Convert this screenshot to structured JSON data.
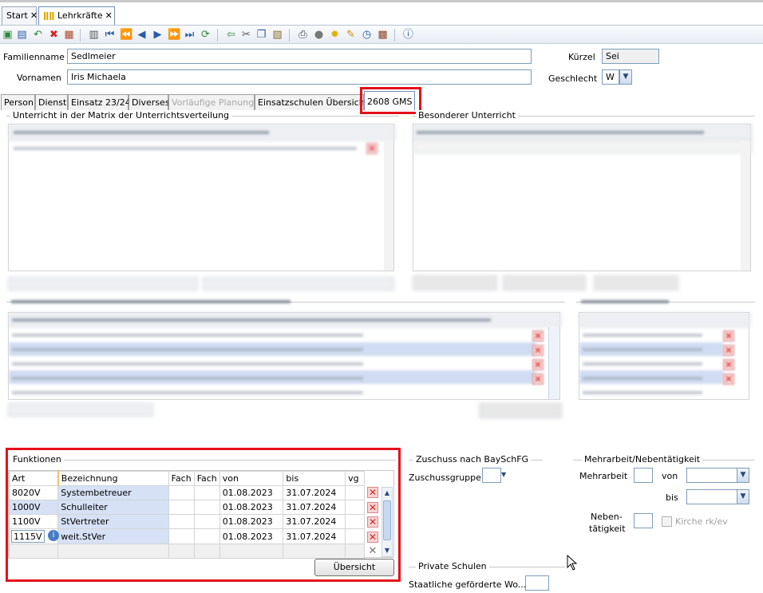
{
  "tabs": [
    {
      "label": "Start"
    },
    {
      "label": "Lehrkräfte"
    }
  ],
  "form": {
    "familienname_label": "Familienname",
    "familienname_value": "Sedlmeier",
    "vornamen_label": "Vornamen",
    "vornamen_value": "Iris Michaela",
    "kuerzel_label": "Kürzel",
    "kuerzel_value": "Sei",
    "geschlecht_label": "Geschlecht",
    "geschlecht_value": "W"
  },
  "page_tabs": [
    "Person",
    "Dienst",
    "Einsatz 23/24",
    "Diverses",
    "Vorläufige Planung",
    "Einsatzschulen Übersicht",
    "2608 GMS"
  ],
  "groups": {
    "matrix": "Unterricht in der Matrix der Unterrichtsverteilung",
    "besonderer": "Besonderer Unterricht",
    "funktionen": "Funktionen",
    "zuschuss": "Zuschuss nach BaySchFG",
    "mehrarbeit": "Mehrarbeit/Nebentätigkeit",
    "private": "Private Schulen"
  },
  "funktionen": {
    "headers": [
      "Art",
      "Bezeichnung",
      "Fach",
      "Fach",
      "von",
      "bis",
      "vg"
    ],
    "rows": [
      {
        "art": "8020V",
        "bez": "Systembetreuer",
        "von": "01.08.2023",
        "bis": "31.07.2024"
      },
      {
        "art": "1000V",
        "bez": "Schulleiter",
        "von": "01.08.2023",
        "bis": "31.07.2024"
      },
      {
        "art": "1100V",
        "bez": "StVertreter",
        "von": "01.08.2023",
        "bis": "31.07.2024"
      },
      {
        "art": "1115V",
        "bez": "weit.StVer",
        "von": "01.08.2023",
        "bis": "31.07.2024"
      }
    ],
    "button": "Übersicht"
  },
  "zuschuss": {
    "gruppe_label": "Zuschussgruppe"
  },
  "mehrarbeit": {
    "label": "Mehrarbeit",
    "von_label": "von",
    "bis_label": "bis",
    "neben_label1": "Neben-",
    "neben_label2": "tätigkeit",
    "kirche_label": "Kirche rk/ev"
  },
  "private": {
    "label": "Staatliche geförderte Wo..."
  }
}
